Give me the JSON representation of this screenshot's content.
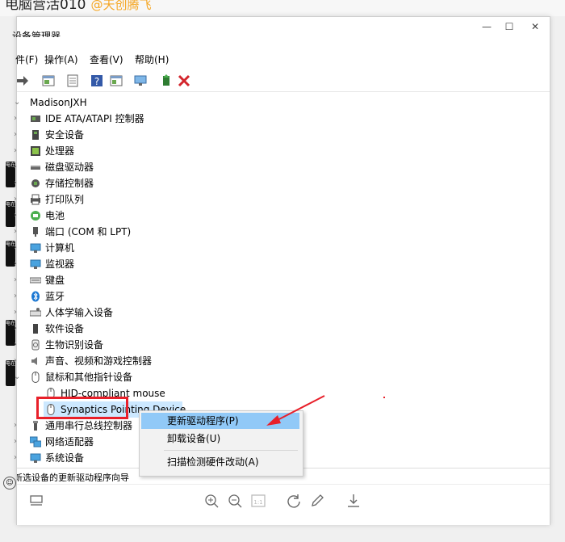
{
  "article": {
    "title": "电脑营活010",
    "author": "@天创腾飞"
  },
  "window": {
    "title": "设备管理器",
    "controls": {
      "minimize": "—",
      "maximize": "☐",
      "close": "✕"
    }
  },
  "menu": [
    "件(F)",
    "操作(A)",
    "查看(V)",
    "帮助(H)"
  ],
  "tree": {
    "root": "MadisonJXH",
    "items": [
      {
        "label": "IDE ATA/ATAPI 控制器",
        "icon": "ide-controller-icon",
        "expanded": false
      },
      {
        "label": "安全设备",
        "icon": "security-device-icon",
        "expanded": false
      },
      {
        "label": "处理器",
        "icon": "processor-icon",
        "expanded": false
      },
      {
        "label": "磁盘驱动器",
        "icon": "disk-drive-icon",
        "expanded": false
      },
      {
        "label": "存储控制器",
        "icon": "storage-controller-icon",
        "expanded": false
      },
      {
        "label": "打印队列",
        "icon": "printer-icon",
        "expanded": false
      },
      {
        "label": "电池",
        "icon": "battery-icon",
        "expanded": false
      },
      {
        "label": "端口 (COM 和 LPT)",
        "icon": "port-icon",
        "expanded": false
      },
      {
        "label": "计算机",
        "icon": "computer-icon",
        "expanded": false
      },
      {
        "label": "监视器",
        "icon": "monitor-icon",
        "expanded": false
      },
      {
        "label": "键盘",
        "icon": "keyboard-icon",
        "expanded": false
      },
      {
        "label": "蓝牙",
        "icon": "bluetooth-icon",
        "expanded": false
      },
      {
        "label": "人体学输入设备",
        "icon": "hid-icon",
        "expanded": false
      },
      {
        "label": "软件设备",
        "icon": "software-device-icon",
        "expanded": false
      },
      {
        "label": "生物识别设备",
        "icon": "biometric-icon",
        "expanded": false
      },
      {
        "label": "声音、视频和游戏控制器",
        "icon": "sound-icon",
        "expanded": false
      },
      {
        "label": "鼠标和其他指针设备",
        "icon": "mouse-icon",
        "expanded": true
      },
      {
        "label": "HID-compliant mouse",
        "icon": "mouse-icon",
        "child": true
      },
      {
        "label": "Synaptics Pointing Device",
        "icon": "mouse-icon",
        "child": true,
        "selected": true
      },
      {
        "label": "通用串行总线控制器",
        "icon": "usb-icon",
        "expanded": false
      },
      {
        "label": "网络适配器",
        "icon": "network-icon",
        "expanded": false
      },
      {
        "label": "系统设备",
        "icon": "system-device-icon",
        "expanded": false
      }
    ]
  },
  "context_menu": {
    "update_driver": "更新驱动程序(P)",
    "uninstall": "卸载设备(U)",
    "scan": "扫描检测硬件改动(A)"
  },
  "status": "新选设备的更新驱动程序向导",
  "side_labels": [
    "电在",
    "电在",
    "电在",
    "电在",
    "电在"
  ],
  "colors": {
    "selection": "#cce8ff",
    "menu_highlight": "#91c9f7",
    "annotation": "#e8202a"
  }
}
